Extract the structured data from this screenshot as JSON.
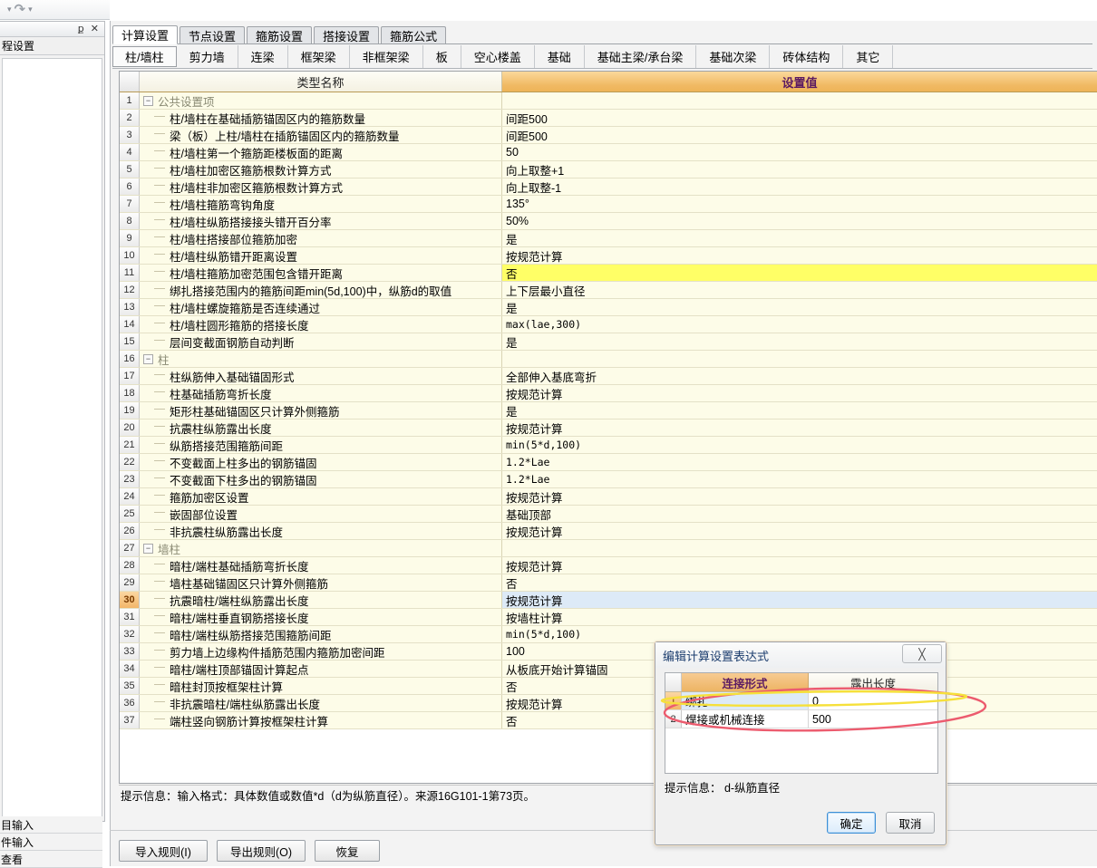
{
  "toolbar": {
    "undo_arrow": "▾",
    "redo_icon": "↷",
    "redo_arrow": "▾"
  },
  "left_dock": {
    "pin_icon": "ք",
    "close_icon": "✕",
    "header_label": "程设置",
    "bottom_items": [
      "目输入",
      "件输入",
      "查看"
    ]
  },
  "tabs_primary": [
    {
      "label": "计算设置",
      "active": true
    },
    {
      "label": "节点设置",
      "active": false
    },
    {
      "label": "箍筋设置",
      "active": false
    },
    {
      "label": "搭接设置",
      "active": false
    },
    {
      "label": "箍筋公式",
      "active": false
    }
  ],
  "tabs_secondary": [
    {
      "label": "柱/墙柱",
      "active": true
    },
    {
      "label": "剪力墙",
      "active": false
    },
    {
      "label": "连梁",
      "active": false
    },
    {
      "label": "框架梁",
      "active": false
    },
    {
      "label": "非框架梁",
      "active": false
    },
    {
      "label": "板",
      "active": false
    },
    {
      "label": "空心楼盖",
      "active": false
    },
    {
      "label": "基础",
      "active": false
    },
    {
      "label": "基础主梁/承台梁",
      "active": false
    },
    {
      "label": "基础次梁",
      "active": false
    },
    {
      "label": "砖体结构",
      "active": false
    },
    {
      "label": "其它",
      "active": false
    }
  ],
  "grid": {
    "columns": {
      "name": "类型名称",
      "value": "设置值"
    },
    "expander_glyph": "−",
    "rows": [
      {
        "n": "1",
        "kind": "group",
        "name": "公共设置项",
        "value": ""
      },
      {
        "n": "2",
        "kind": "item",
        "name": "柱/墙柱在基础插筋锚固区内的箍筋数量",
        "value": "间距500"
      },
      {
        "n": "3",
        "kind": "item",
        "name": "梁（板）上柱/墙柱在插筋锚固区内的箍筋数量",
        "value": "间距500"
      },
      {
        "n": "4",
        "kind": "item",
        "name": "柱/墙柱第一个箍筋距楼板面的距离",
        "value": "50"
      },
      {
        "n": "5",
        "kind": "item",
        "name": "柱/墙柱加密区箍筋根数计算方式",
        "value": "向上取整+1"
      },
      {
        "n": "6",
        "kind": "item",
        "name": "柱/墙柱非加密区箍筋根数计算方式",
        "value": "向上取整-1"
      },
      {
        "n": "7",
        "kind": "item",
        "name": "柱/墙柱箍筋弯钩角度",
        "value": "135°"
      },
      {
        "n": "8",
        "kind": "item",
        "name": "柱/墙柱纵筋搭接接头错开百分率",
        "value": "50%"
      },
      {
        "n": "9",
        "kind": "item",
        "name": "柱/墙柱搭接部位箍筋加密",
        "value": "是"
      },
      {
        "n": "10",
        "kind": "item",
        "name": "柱/墙柱纵筋错开距离设置",
        "value": "按规范计算"
      },
      {
        "n": "11",
        "kind": "item",
        "name": "柱/墙柱箍筋加密范围包含错开距离",
        "value": "否",
        "highlight": "yellow"
      },
      {
        "n": "12",
        "kind": "item",
        "name": "绑扎搭接范围内的箍筋间距min(5d,100)中，纵筋d的取值",
        "value": "上下层最小直径"
      },
      {
        "n": "13",
        "kind": "item",
        "name": "柱/墙柱螺旋箍筋是否连续通过",
        "value": "是"
      },
      {
        "n": "14",
        "kind": "item",
        "name": "柱/墙柱圆形箍筋的搭接长度",
        "value": "max(lae,300)",
        "mono": true
      },
      {
        "n": "15",
        "kind": "item",
        "name": "层间变截面钢筋自动判断",
        "value": "是"
      },
      {
        "n": "16",
        "kind": "group",
        "name": "柱",
        "value": ""
      },
      {
        "n": "17",
        "kind": "item",
        "name": "柱纵筋伸入基础锚固形式",
        "value": "全部伸入基底弯折"
      },
      {
        "n": "18",
        "kind": "item",
        "name": "柱基础插筋弯折长度",
        "value": "按规范计算"
      },
      {
        "n": "19",
        "kind": "item",
        "name": "矩形柱基础锚固区只计算外侧箍筋",
        "value": "是"
      },
      {
        "n": "20",
        "kind": "item",
        "name": "抗震柱纵筋露出长度",
        "value": "按规范计算"
      },
      {
        "n": "21",
        "kind": "item",
        "name": "纵筋搭接范围箍筋间距",
        "value": "min(5*d,100)",
        "mono": true
      },
      {
        "n": "22",
        "kind": "item",
        "name": "不变截面上柱多出的钢筋锚固",
        "value": "1.2*Lae",
        "mono": true
      },
      {
        "n": "23",
        "kind": "item",
        "name": "不变截面下柱多出的钢筋锚固",
        "value": "1.2*Lae",
        "mono": true
      },
      {
        "n": "24",
        "kind": "item",
        "name": "箍筋加密区设置",
        "value": "按规范计算"
      },
      {
        "n": "25",
        "kind": "item",
        "name": "嵌固部位设置",
        "value": "基础顶部"
      },
      {
        "n": "26",
        "kind": "item",
        "name": "非抗震柱纵筋露出长度",
        "value": "按规范计算"
      },
      {
        "n": "27",
        "kind": "group",
        "name": "墙柱",
        "value": ""
      },
      {
        "n": "28",
        "kind": "item",
        "name": "暗柱/端柱基础插筋弯折长度",
        "value": "按规范计算"
      },
      {
        "n": "29",
        "kind": "item",
        "name": "墙柱基础锚固区只计算外侧箍筋",
        "value": "否"
      },
      {
        "n": "30",
        "kind": "item",
        "name": "抗震暗柱/端柱纵筋露出长度",
        "value": "按规范计算",
        "selected": true
      },
      {
        "n": "31",
        "kind": "item",
        "name": "暗柱/端柱垂直钢筋搭接长度",
        "value": "按墙柱计算"
      },
      {
        "n": "32",
        "kind": "item",
        "name": "暗柱/端柱纵筋搭接范围箍筋间距",
        "value": "min(5*d,100)",
        "mono": true
      },
      {
        "n": "33",
        "kind": "item",
        "name": "剪力墙上边缘构件插筋范围内箍筋加密间距",
        "value": "100"
      },
      {
        "n": "34",
        "kind": "item",
        "name": "暗柱/端柱顶部锚固计算起点",
        "value": "从板底开始计算锚固"
      },
      {
        "n": "35",
        "kind": "item",
        "name": "暗柱封顶按框架柱计算",
        "value": "否"
      },
      {
        "n": "36",
        "kind": "item",
        "name": "非抗震暗柱/端柱纵筋露出长度",
        "value": "按规范计算"
      },
      {
        "n": "37",
        "kind": "item",
        "name": "端柱竖向钢筋计算按框架柱计算",
        "value": "否"
      }
    ]
  },
  "hint_bar": {
    "text": "提示信息：输入格式：具体数值或数值*d（d为纵筋直径）。来源16G101-1第73页。"
  },
  "bottom_buttons": [
    {
      "label": "导入规则(I)"
    },
    {
      "label": "导出规则(O)"
    },
    {
      "label": "恢复"
    }
  ],
  "dialog": {
    "title": "编辑计算设置表达式",
    "close_icon": "╳",
    "columns": {
      "connection": "连接形式",
      "exposed_length": "露出长度"
    },
    "rows": [
      {
        "n": "1",
        "connection": "绑扎",
        "value": "0",
        "selected": true
      },
      {
        "n": "2",
        "connection": "焊接或机械连接",
        "value": "500",
        "selected": false
      }
    ],
    "hint": "提示信息： d-纵筋直径",
    "ok_label": "确定",
    "cancel_label": "取消"
  },
  "annotations": {
    "red_ellipse_color": "#ec5b6e",
    "yellow_ellipse_color": "#f6e03a"
  }
}
